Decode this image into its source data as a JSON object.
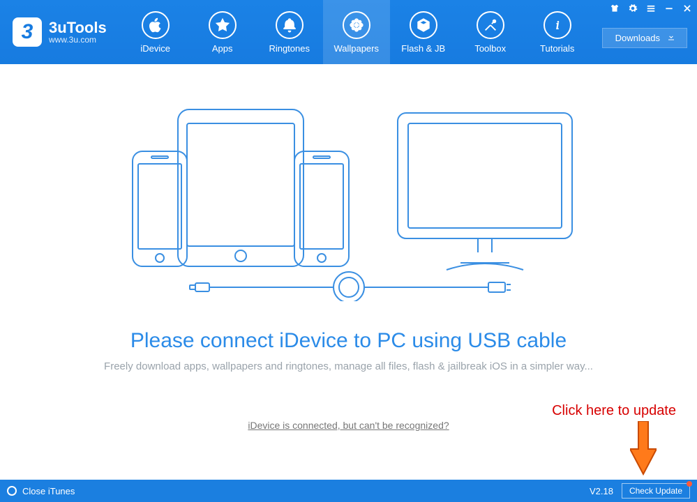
{
  "brand": {
    "title": "3uTools",
    "subtitle": "www.3u.com"
  },
  "tabs": [
    {
      "label": "iDevice"
    },
    {
      "label": "Apps"
    },
    {
      "label": "Ringtones"
    },
    {
      "label": "Wallpapers"
    },
    {
      "label": "Flash & JB"
    },
    {
      "label": "Toolbox"
    },
    {
      "label": "Tutorials"
    }
  ],
  "downloads_label": "Downloads",
  "main": {
    "headline": "Please connect iDevice to PC using USB cable",
    "subline": "Freely download apps, wallpapers and ringtones, manage all files, flash & jailbreak iOS in a simpler way...",
    "help_link": "iDevice is connected, but can't be recognized?"
  },
  "annotation": {
    "text": "Click here to update"
  },
  "statusbar": {
    "close_itunes": "Close iTunes",
    "version": "V2.18",
    "check_update": "Check Update"
  }
}
